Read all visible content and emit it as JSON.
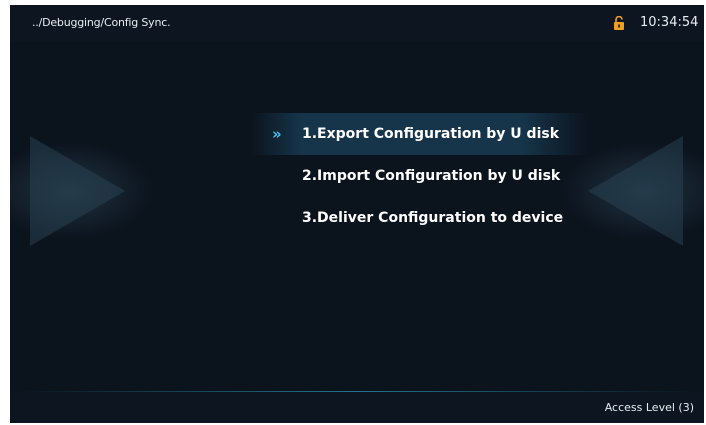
{
  "header": {
    "breadcrumb": "../Debugging/Config Sync.",
    "time": "10:34:54",
    "lock_icon": "unlocked-padlock-icon"
  },
  "menu": {
    "selected_indicator": "»",
    "items": [
      {
        "label": "1.Export Configuration by U disk",
        "selected": true
      },
      {
        "label": "2.Import Configuration by U disk",
        "selected": false
      },
      {
        "label": "3.Deliver Configuration to device",
        "selected": false
      }
    ]
  },
  "footer": {
    "access_level": "Access Level  (3)"
  },
  "colors": {
    "background": "#0b131d",
    "accent": "#3ec3f0",
    "text": "#ffffff",
    "lock": "#f0a020"
  }
}
